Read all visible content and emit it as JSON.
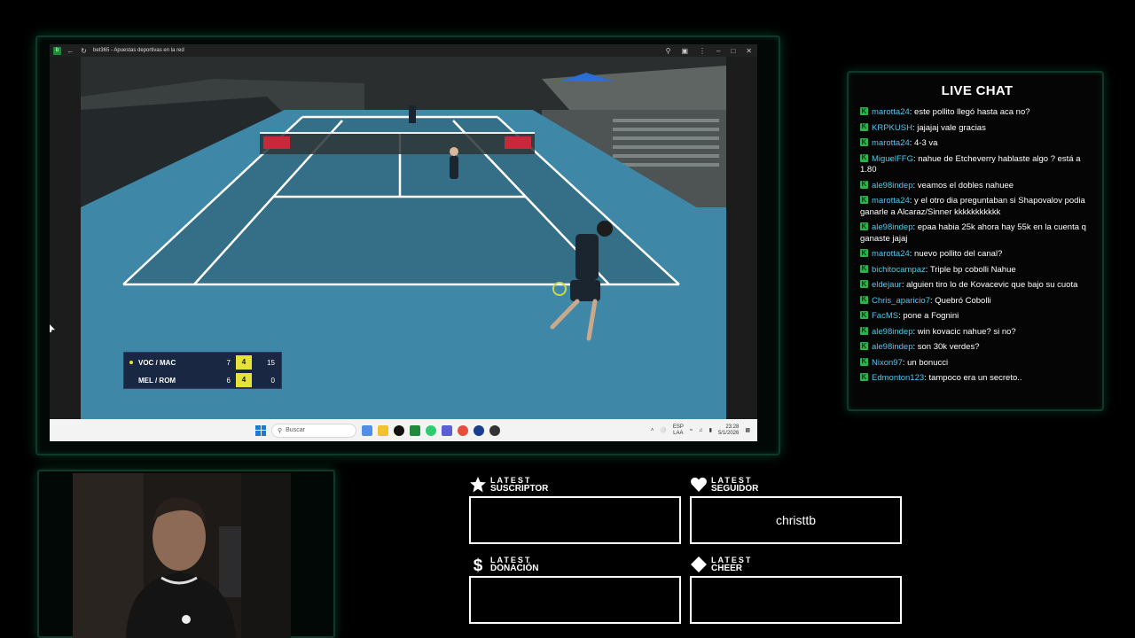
{
  "browser": {
    "title": "bet365 - Apuestas deportivas en la red"
  },
  "scoreboard": {
    "rows": [
      {
        "team": "VOC / MAC",
        "set": "7",
        "game": "4",
        "points": "15"
      },
      {
        "team": "MEL / ROM",
        "set": "6",
        "game": "4",
        "points": "0"
      }
    ]
  },
  "taskbar": {
    "search_placeholder": "Buscar",
    "lang_1": "ESP",
    "lang_2": "LAA",
    "time": "23:28",
    "date": "5/1/2026"
  },
  "chat": {
    "title": "LIVE CHAT",
    "messages": [
      {
        "user": "marotta24",
        "text": ": este pollito llegó hasta aca no?"
      },
      {
        "user": "KRPKUSH",
        "text": ": jajajaj vale gracias"
      },
      {
        "user": "marotta24",
        "text": ": 4-3 va"
      },
      {
        "user": "MiguelFFG",
        "text": ": nahue de Etcheverry hablaste algo ? está a 1.80"
      },
      {
        "user": "ale98indep",
        "text": ": veamos el dobles nahuee"
      },
      {
        "user": "marotta24",
        "text": ": y el otro dia preguntaban si Shapovalov podia ganarle a Alcaraz/Sinner kkkkkkkkkkk"
      },
      {
        "user": "ale98indep",
        "text": ": epaa habia 25k ahora hay 55k en la cuenta q ganaste jajaj"
      },
      {
        "user": "marotta24",
        "text": ": nuevo pollito del canal?"
      },
      {
        "user": "bichitocampaz",
        "text": ": Triple bp cobolli Nahue"
      },
      {
        "user": "eldejaur",
        "text": ": alguien tiro lo de Kovacevic que bajo su cuota"
      },
      {
        "user": "Chris_aparicio7",
        "text": ": Quebró Cobolli"
      },
      {
        "user": "FacMS",
        "text": ": pone a Fognini"
      },
      {
        "user": "ale98indep",
        "text": ": win kovacic nahue? si no?"
      },
      {
        "user": "ale98indep",
        "text": ": son 30k verdes?"
      },
      {
        "user": "Nixon97",
        "text": ": un bonucci"
      },
      {
        "user": "Edmonton123",
        "text": ": tampoco era un secreto.."
      }
    ]
  },
  "alerts": {
    "latest_label": "LATEST",
    "suscriptor": {
      "label": "SUSCRIPTOR",
      "value": ""
    },
    "seguidor": {
      "label": "SEGUIDOR",
      "value": "christtb"
    },
    "donacion": {
      "label": "DONACIÓN",
      "value": ""
    },
    "cheer": {
      "label": "CHEER",
      "value": ""
    }
  },
  "colors": {
    "accent_green": "#2bb24c",
    "chat_username": "#4ec8ef",
    "court_blue": "#3e87a6",
    "score_yellow": "#e6e23a"
  }
}
